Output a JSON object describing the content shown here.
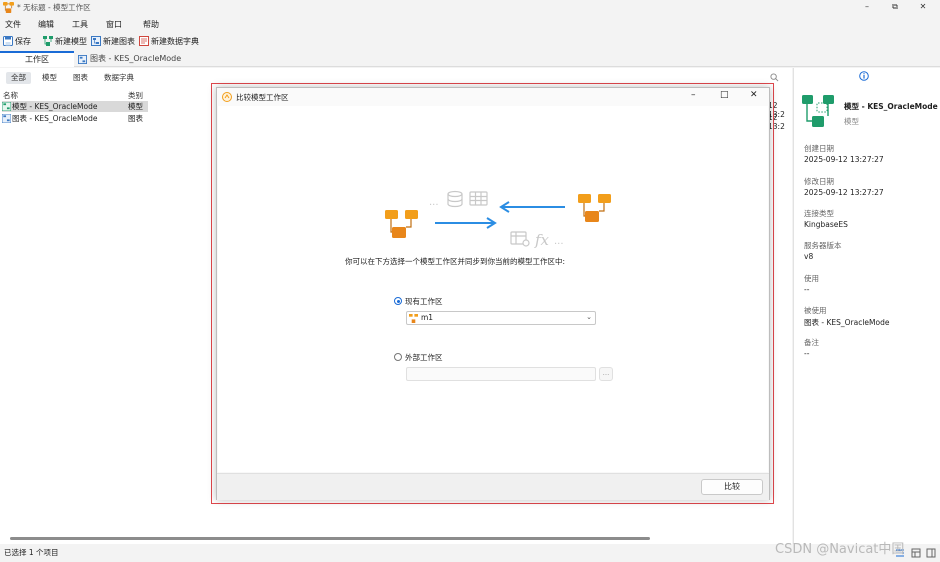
{
  "window": {
    "title": "* 无标题 - 模型工作区"
  },
  "menu": [
    "文件",
    "编辑",
    "工具",
    "窗口",
    "帮助"
  ],
  "toolbar": {
    "save": "保存",
    "new_model": "新建模型",
    "new_chart": "新建图表",
    "new_dictionary": "新建数据字典"
  },
  "doc_tabs": {
    "workspace": "工作区",
    "chart": "图表 - KES_OracleMode"
  },
  "filter_tabs": [
    "全部",
    "模型",
    "图表",
    "数据字典"
  ],
  "list": {
    "col_name": "名称",
    "col_type": "类别",
    "rows": [
      {
        "name": "模型 - KES_OracleMode",
        "type": "模型",
        "time": "12 13:2"
      },
      {
        "name": "图表 - KES_OracleMode",
        "type": "图表",
        "time": "12 13:2"
      }
    ]
  },
  "info_panel": {
    "name": "模型 - KES_OracleMode",
    "kind": "模型",
    "fields": [
      {
        "label": "创建日期",
        "value": "2025-09-12 13:27:27"
      },
      {
        "label": "修改日期",
        "value": "2025-09-12 13:27:27"
      },
      {
        "label": "连接类型",
        "value": "KingbaseES"
      },
      {
        "label": "服务器版本",
        "value": "v8"
      },
      {
        "label": "使用",
        "value": "--"
      },
      {
        "label": "被使用",
        "value": "图表 - KES_OracleMode"
      },
      {
        "label": "备注",
        "value": "--"
      }
    ]
  },
  "dialog": {
    "title": "比较模型工作区",
    "instruction": "你可以在下方选择一个模型工作区并同步到你当前的模型工作区中:",
    "existing_label": "现有工作区",
    "existing_value": "m1",
    "external_label": "外部工作区",
    "external_value": "",
    "browse": "...",
    "compare_button": "比较"
  },
  "status": {
    "text": "已选择 1 个项目"
  },
  "watermark": "CSDN @Navicat中国",
  "colors": {
    "accent": "#1a6bd6",
    "highlight_frame": "#e0474c",
    "model_orange": "#f29e1b",
    "model_green": "#1f9c6b",
    "arrow_blue": "#2b8de3"
  }
}
